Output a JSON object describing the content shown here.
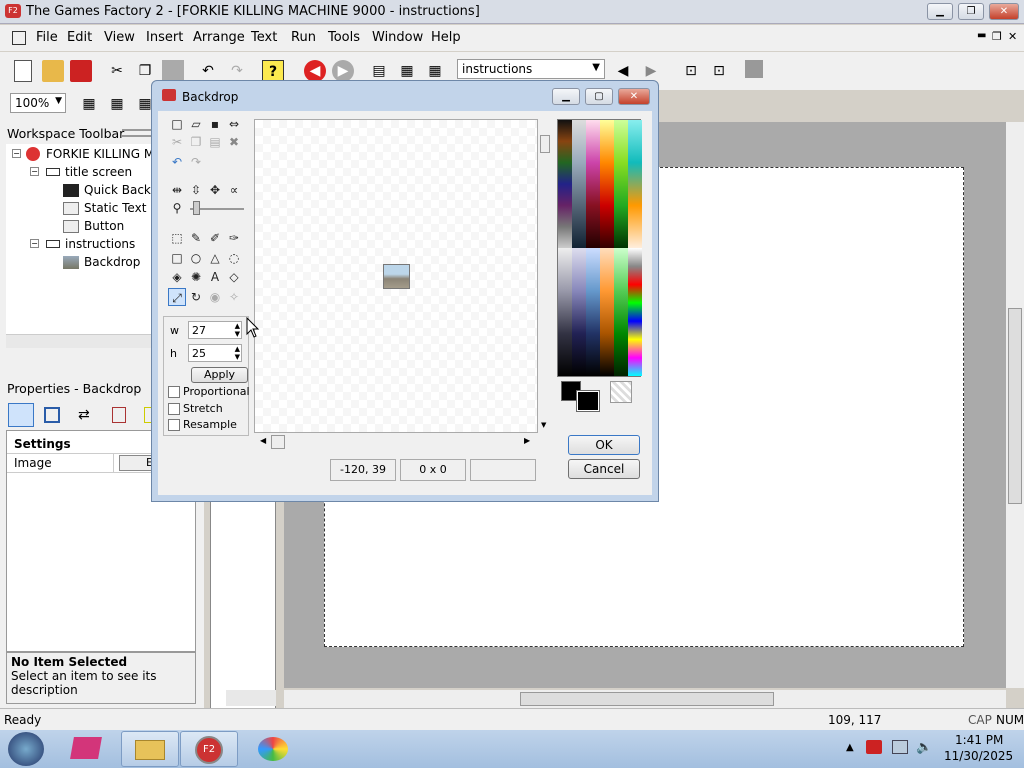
{
  "window": {
    "title": "The Games Factory 2 - [FORKIE KILLING MACHINE 9000 - instructions]",
    "minimize": "▁",
    "maximize": "❐",
    "close": "✕"
  },
  "menu": [
    "File",
    "Edit",
    "View",
    "Insert",
    "Arrange",
    "Text",
    "Run",
    "Tools",
    "Window",
    "Help"
  ],
  "mdi_controls": [
    "▬",
    "❐",
    "✕"
  ],
  "toolbar": {
    "frame_select": "instructions",
    "zoom": "100%"
  },
  "workspace": {
    "title": "Workspace Toolbar",
    "items": [
      {
        "label": "FORKIE KILLING MA"
      },
      {
        "label": "title screen"
      },
      {
        "label": "Quick Backd"
      },
      {
        "label": "Static Text"
      },
      {
        "label": "Button"
      },
      {
        "label": "instructions"
      },
      {
        "label": "Backdrop"
      }
    ]
  },
  "properties": {
    "title": "Properties - Backdrop",
    "section": "Settings",
    "row_label": "Image",
    "row_btn": "E",
    "desc_title": "No Item Selected",
    "desc_text": "Select an item to see its description"
  },
  "dialog": {
    "title": "Backdrop",
    "w_label": "w",
    "w_value": "27",
    "h_label": "h",
    "h_value": "25",
    "apply": "Apply",
    "proportional": "Proportional",
    "stretch": "Stretch",
    "resample": "Resample",
    "coords": "-120, 39",
    "size": "0 x 0",
    "ok": "OK",
    "cancel": "Cancel"
  },
  "status": {
    "left": "Ready",
    "coords": "109, 117",
    "cap": "CAP",
    "num": "NUM"
  },
  "clock": {
    "time": "1:41 PM",
    "date": "11/30/2025"
  },
  "colors": {
    "accent": "#3a78c6",
    "titlebar": "#d8dde6",
    "dialog_frame": "#c2d4ea"
  }
}
